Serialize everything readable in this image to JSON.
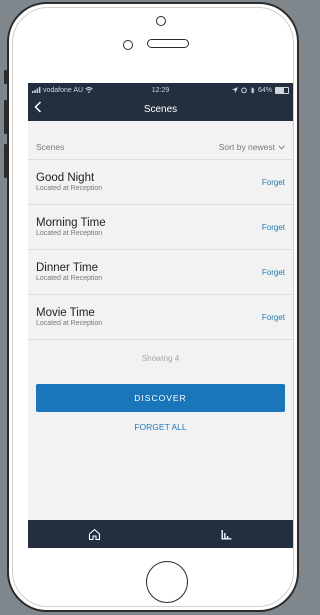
{
  "status": {
    "carrier": "vodafone AU",
    "time": "12:29",
    "battery_percent": "64%",
    "battery_level": 0.64
  },
  "nav": {
    "title": "Scenes",
    "back_icon": "chevron-left-icon"
  },
  "list": {
    "header_label": "Scenes",
    "sort_label": "Sort by newest",
    "items": [
      {
        "name": "Good Night",
        "location": "Located at Reception",
        "action": "Forget"
      },
      {
        "name": "Morning Time",
        "location": "Located at Reception",
        "action": "Forget"
      },
      {
        "name": "Dinner Time",
        "location": "Located at Reception",
        "action": "Forget"
      },
      {
        "name": "Movie Time",
        "location": "Located at Reception",
        "action": "Forget"
      }
    ],
    "showing_text": "Showing 4"
  },
  "actions": {
    "discover_label": "DISCOVER",
    "forget_all_label": "FORGET ALL"
  },
  "tabs": [
    {
      "icon": "home-icon"
    },
    {
      "icon": "chart-icon"
    }
  ],
  "colors": {
    "header_bg": "#232f3e",
    "accent": "#1b75bb",
    "link": "#1f7ab8"
  }
}
